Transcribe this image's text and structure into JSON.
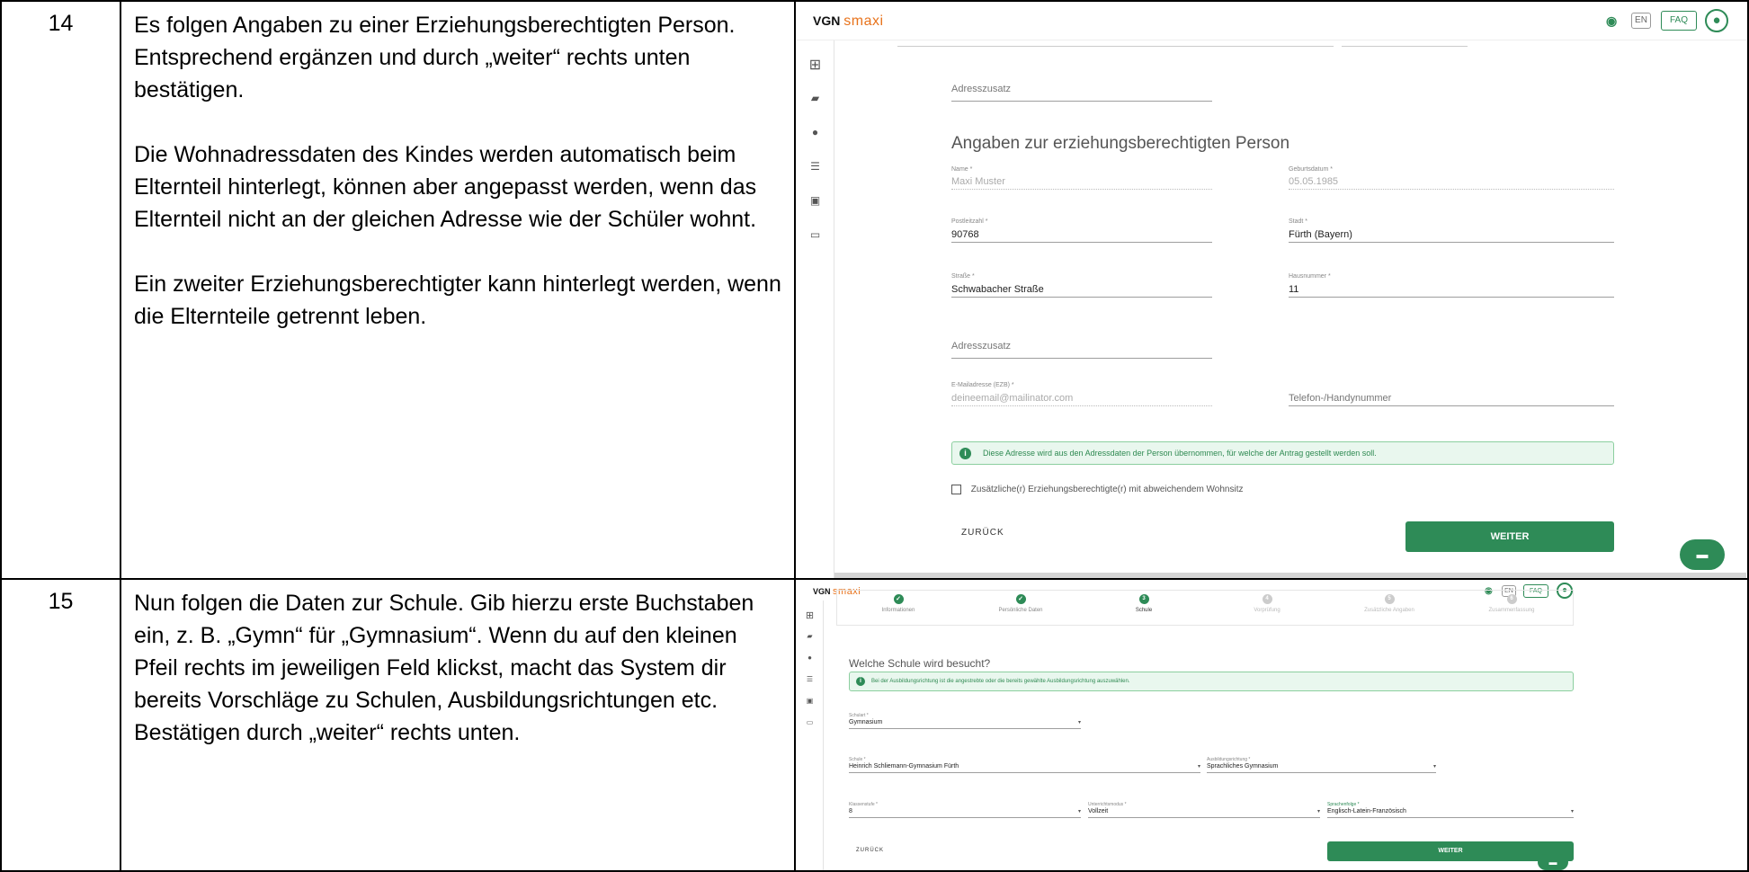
{
  "rows": [
    {
      "number": "14",
      "paragraphs": [
        "Es folgen Angaben zu einer Erziehungsberechtigten Person.",
        "Entsprechend ergänzen und durch „weiter“ rechts unten bestätigen.",
        "",
        "Die Wohnadressdaten des Kindes werden automatisch beim Elternteil hinterlegt, können aber angepasst werden, wenn das Elternteil nicht an der gleichen Adresse wie der Schüler wohnt.",
        "",
        "Ein zweiter Erziehungsberechtigter kann hinterlegt werden, wenn die Elternteile getrennt leben."
      ]
    },
    {
      "number": "15",
      "paragraphs": [
        "Nun folgen die Daten zur Schule. Gib hierzu erste Buchstaben ein, z. B. „Gymn“ für „Gymnasium“. Wenn du auf den kleinen Pfeil rechts im jeweiligen Feld klickst, macht das System dir bereits Vorschläge zu Schulen, Ausbildungsrichtungen etc.",
        "Bestätigen durch „weiter“ rechts unten."
      ]
    }
  ],
  "app": {
    "brand_vgn": "VGN",
    "brand_smaxi": "smaxi",
    "eye_icon": "eye-icon",
    "lang_button": "EN",
    "faq_button": "FAQ",
    "avatar_icon": "user-avatar-icon",
    "sidebar_icons": [
      "dashboard-icon",
      "folder-icon",
      "person-icon",
      "person-list-icon",
      "id-card-icon",
      "chat-icon"
    ],
    "accent_color": "#2e8b57",
    "brand_accent_color": "#e8731c"
  },
  "screen1": {
    "adresszusatz_top": "Adresszusatz",
    "section_title": "Angaben zur erziehungsberechtigten Person",
    "fields": {
      "name": {
        "label": "Name *",
        "value": "Maxi Muster"
      },
      "geburtsdatum": {
        "label": "Geburtsdatum *",
        "value": "05.05.1985"
      },
      "plz": {
        "label": "Postleitzahl *",
        "value": "90768"
      },
      "stadt": {
        "label": "Stadt *",
        "value": "Fürth (Bayern)"
      },
      "strasse": {
        "label": "Straße *",
        "value": "Schwabacher Straße"
      },
      "hausnummer": {
        "label": "Hausnummer *",
        "value": "11"
      },
      "adresszusatz": {
        "placeholder": "Adresszusatz"
      },
      "email": {
        "label": "E-Mailadresse (EZB) *",
        "value": "deineemail@mailinator.com"
      },
      "telefon": {
        "placeholder": "Telefon-/Handynummer"
      }
    },
    "info_text": "Diese Adresse wird aus den Adressdaten der Person übernommen, für welche der Antrag gestellt werden soll.",
    "checkbox_label": "Zusätzliche(r) Erziehungsberechtigte(r) mit abweichendem Wohnsitz",
    "back_label": "ZURÜCK",
    "next_label": "WEITER",
    "chat_icon": "chat-bubble-icon"
  },
  "screen2": {
    "steps": [
      {
        "label": "Informationen",
        "state": "done"
      },
      {
        "label": "Persönliche Daten",
        "state": "done"
      },
      {
        "label": "Schule",
        "num": "3",
        "state": "current"
      },
      {
        "label": "Vorprüfung",
        "num": "4",
        "state": "todo"
      },
      {
        "label": "Zusätzliche Angaben",
        "num": "5",
        "state": "todo"
      },
      {
        "label": "Zusammenfassung",
        "num": "6",
        "state": "todo"
      }
    ],
    "title": "Welche Schule wird besucht?",
    "info_text": "Bei der Ausbildungsrichtung ist die angestrebte oder die bereits gewählte Ausbildungsrichtung auszuwählen.",
    "fields": {
      "schulart": {
        "label": "Schulart *",
        "value": "Gymnasium"
      },
      "schule": {
        "label": "Schule *",
        "value": "Heinrich Schliemann-Gymnasium Fürth"
      },
      "ausbildungsrichtung": {
        "label": "Ausbildungsrichtung *",
        "value": "Sprachliches Gymnasium"
      },
      "klassenstufe": {
        "label": "Klassenstufe *",
        "value": "8"
      },
      "unterrichtsmodus": {
        "label": "Unterrichtsmodus *",
        "value": "Vollzeit"
      },
      "sprachenfolge": {
        "label": "Sprachenfolge *",
        "value": "Englisch-Latein-Französisch"
      }
    },
    "back_label": "ZURÜCK",
    "next_label": "WEITER",
    "chat_icon": "chat-bubble-icon"
  }
}
